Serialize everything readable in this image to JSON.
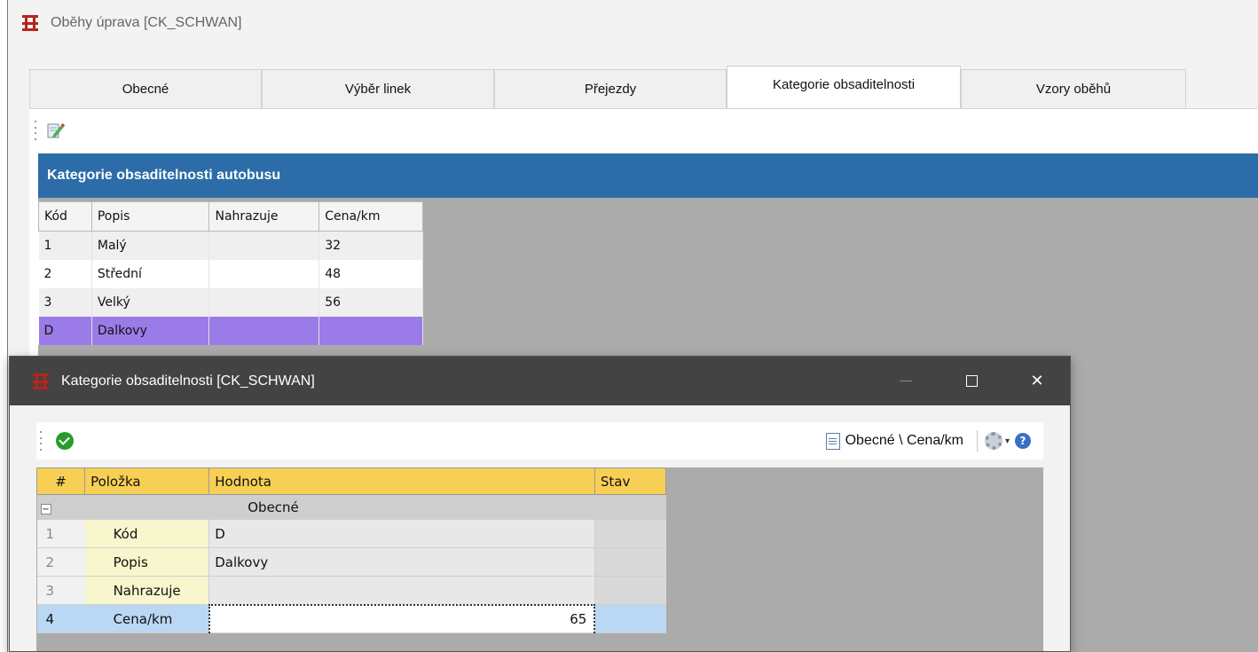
{
  "main_window": {
    "title": "Oběhy úprava [CK_SCHWAN]",
    "tabs": [
      "Obecné",
      "Výběr linek",
      "Přejezdy",
      "Kategorie obsaditelnosti",
      "Vzory oběhů"
    ],
    "active_tab": "Kategorie obsaditelnosti"
  },
  "panel": {
    "header": "Kategorie obsaditelnosti autobusu",
    "columns": [
      "Kód",
      "Popis",
      "Nahrazuje",
      "Cena/km"
    ],
    "rows": [
      {
        "kod": "1",
        "popis": "Malý",
        "nahrazuje": "",
        "cena": "32"
      },
      {
        "kod": "2",
        "popis": "Střední",
        "nahrazuje": "",
        "cena": "48"
      },
      {
        "kod": "3",
        "popis": "Velký",
        "nahrazuje": "",
        "cena": "56"
      },
      {
        "kod": "D",
        "popis": "Dalkovy",
        "nahrazuje": "",
        "cena": ""
      }
    ],
    "selected_row_color": "#9b7be8"
  },
  "dialog": {
    "title": "Kategorie obsaditelnosti [CK_SCHWAN]",
    "breadcrumb": "Obecné \\ Cena/km",
    "columns": [
      "#",
      "Položka",
      "Hodnota",
      "Stav"
    ],
    "group": "Obecné",
    "expander": "−",
    "props": [
      {
        "num": "1",
        "name": "Kód",
        "value": "D"
      },
      {
        "num": "2",
        "name": "Popis",
        "value": "Dalkovy"
      },
      {
        "num": "3",
        "name": "Nahrazuje",
        "value": ""
      },
      {
        "num": "4",
        "name": "Cena/km",
        "value": "65"
      }
    ],
    "window_buttons": {
      "maximize": "☐",
      "close": "✕"
    },
    "help_glyph": "?",
    "dropdown_caret": "▾",
    "header_color": "#f8cf55"
  },
  "colors": {
    "panel_header": "#2c6ca8",
    "dialog_titlebar": "#434343"
  }
}
